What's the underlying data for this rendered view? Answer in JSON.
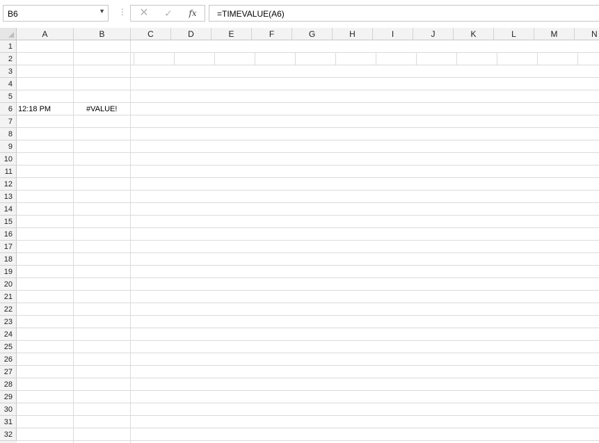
{
  "formula_bar": {
    "name_box": "B6",
    "fx_label": "fx",
    "formula": "=TIMEVALUE(A6)"
  },
  "columns": [
    "A",
    "B",
    "C",
    "D",
    "E",
    "F",
    "G",
    "H",
    "I",
    "J",
    "K",
    "L",
    "M",
    "N"
  ],
  "rows": [
    "1",
    "2",
    "3",
    "4",
    "5",
    "6",
    "7",
    "8",
    "9",
    "10",
    "11",
    "12",
    "13",
    "14",
    "15",
    "16",
    "17",
    "18",
    "19",
    "20",
    "21",
    "22",
    "23",
    "24",
    "25",
    "26",
    "27",
    "28",
    "29",
    "30",
    "31",
    "32"
  ],
  "cells": {
    "A6": "12:18 PM",
    "B6": "#VALUE!"
  },
  "icons": {
    "name_box_dropdown": "chevron-down-icon",
    "cancel": "close-icon",
    "enter": "check-icon",
    "function": "fx-icon",
    "select_all": "select-all-icon"
  }
}
